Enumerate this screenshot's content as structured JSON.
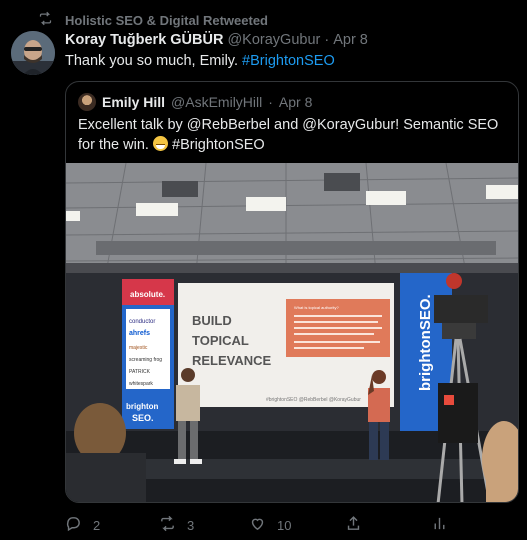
{
  "retweet": {
    "label": "Holistic SEO & Digital Retweeted"
  },
  "tweet": {
    "name": "Koray Tuğberk GÜBÜR",
    "handle": "@KorayGubur",
    "separator": "·",
    "date": "Apr 8",
    "text": "Thank you so much, Emily.",
    "hashtag": "#BrightonSEO"
  },
  "quoted": {
    "name": "Emily Hill",
    "handle": "@AskEmilyHill",
    "separator": "·",
    "date": "Apr 8",
    "text_line1": "Excellent talk by @RebBerbel and @KorayGubur! Semantic SEO for the",
    "text_line2_prefix": "win.",
    "hashtag": "#BrightonSEO",
    "photo": {
      "slide_lines": [
        "BUILD",
        "TOPICAL",
        "RELEVANCE"
      ],
      "slide_footer": "#brightonSEO @RebBerbel @KorayGubur",
      "slide_panel_title": "What is topical authority?",
      "banner_left": [
        "absolute.",
        "conductor",
        "ahrefs",
        "majestic",
        "screaming frog",
        "PATRICK",
        "whitespark",
        "brighton",
        "SEO"
      ],
      "banner_right": "brightonSEO"
    }
  },
  "actions": {
    "replies": "2",
    "retweets": "3",
    "likes": "10"
  },
  "colors": {
    "accent": "#1d9bf0",
    "muted": "#71767b",
    "text": "#e7e9ea",
    "background": "#000000"
  }
}
